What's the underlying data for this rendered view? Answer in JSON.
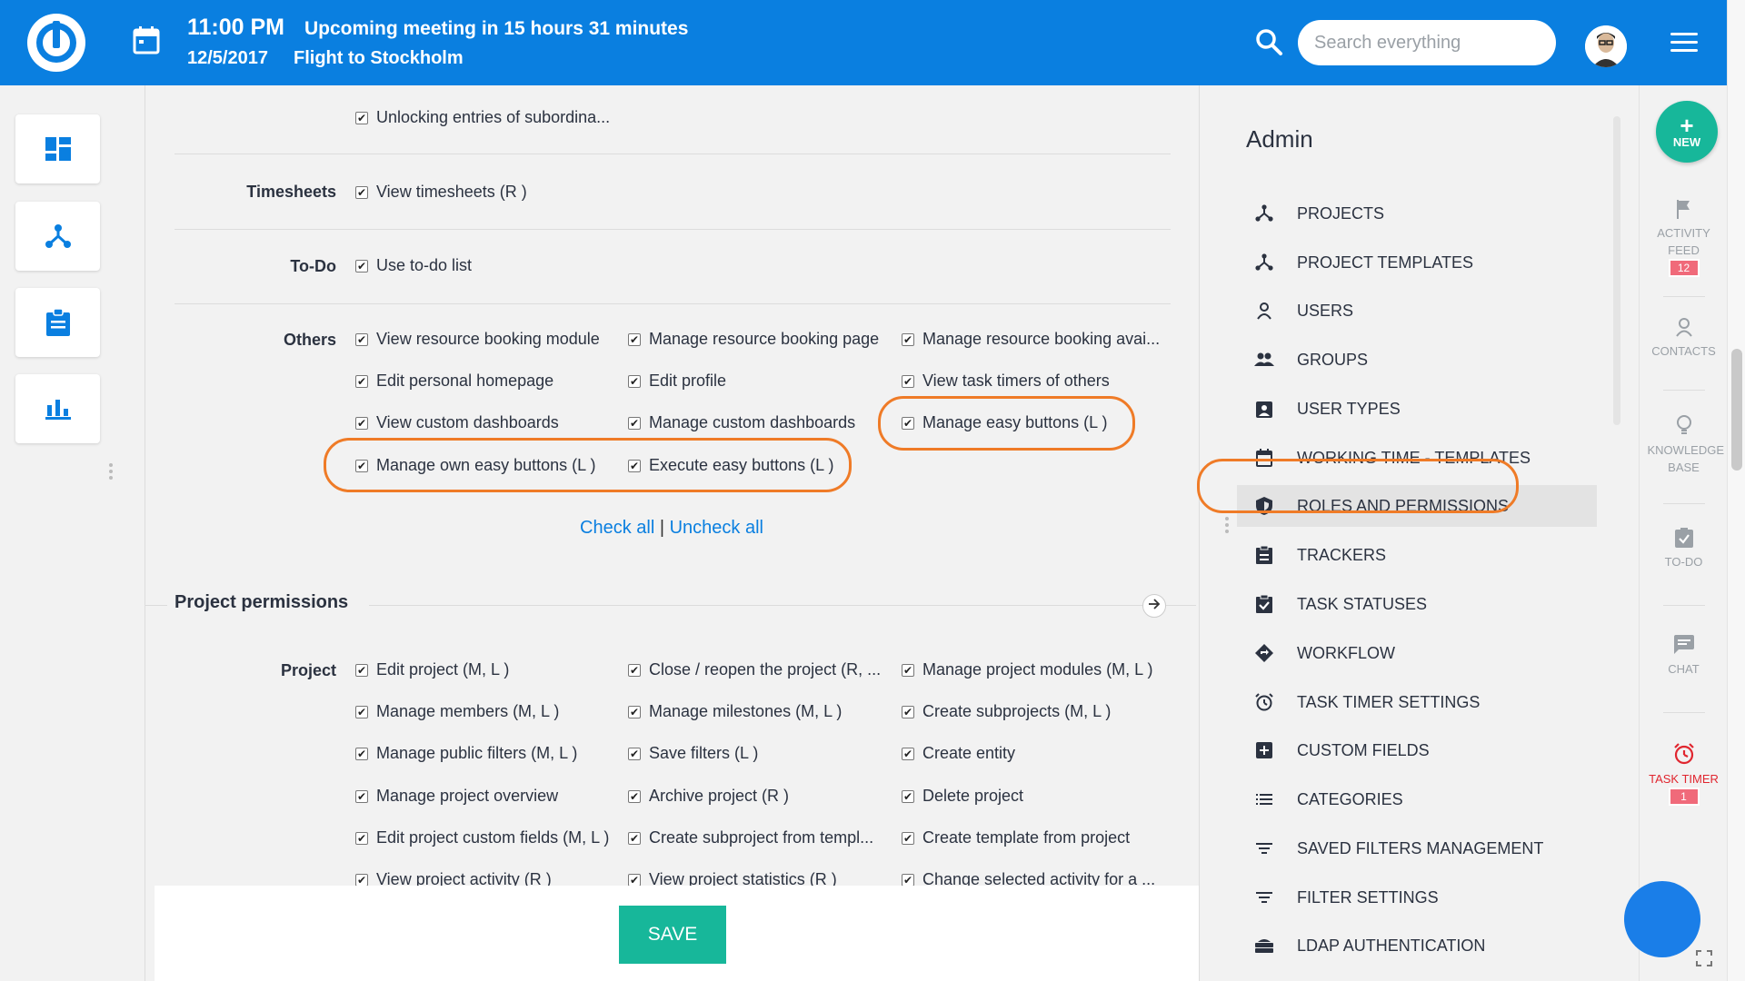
{
  "header": {
    "time": "11:00 PM",
    "upcoming": "Upcoming meeting in 15 hours 31 minutes",
    "date": "12/5/2017",
    "event": "Flight to Stockholm",
    "search_placeholder": "Search everything",
    "brand_color": "#0a7fe0"
  },
  "left_rail": {
    "items": [
      "dashboard-icon",
      "projects-icon",
      "tasks-icon",
      "reports-icon"
    ]
  },
  "permissions": {
    "top_partial": "Unlocking entries of subordina...",
    "timesheets": {
      "label": "Timesheets",
      "items": [
        "View timesheets (R )"
      ]
    },
    "todo": {
      "label": "To-Do",
      "items": [
        "Use to-do list"
      ]
    },
    "others": {
      "label": "Others",
      "items": [
        "View resource booking module",
        "Manage resource booking page",
        "Manage resource booking avai...",
        "Edit personal homepage",
        "Edit profile",
        "View task timers of others",
        "View custom dashboards",
        "Manage custom dashboards",
        "Manage easy buttons (L )",
        "Manage own easy buttons (L )",
        "Execute easy buttons (L )"
      ]
    },
    "check_all": "Check all",
    "separator": "|",
    "uncheck_all": "Uncheck all",
    "project_section_title": "Project permissions",
    "project": {
      "label": "Project",
      "items": [
        "Edit project (M, L )",
        "Close / reopen the project (R, ...",
        "Manage project modules (M, L )",
        "Manage members (M, L )",
        "Manage milestones (M, L )",
        "Create subprojects (M, L )",
        "Manage public filters (M, L )",
        "Save filters (L )",
        "Create entity",
        "Manage project overview",
        "Archive project (R )",
        "Delete project",
        "Edit project custom fields (M, L )",
        "Create subproject from templ...",
        "Create template from project",
        "View project activity (R )",
        "View project statistics (R )",
        "Change selected activity for a ..."
      ]
    },
    "save_label": "SAVE",
    "highlight_color": "#ef7b27"
  },
  "admin": {
    "title": "Admin",
    "items": [
      {
        "label": "PROJECTS",
        "icon": "project-tree-icon"
      },
      {
        "label": "PROJECT TEMPLATES",
        "icon": "project-tree-icon"
      },
      {
        "label": "USERS",
        "icon": "user-icon"
      },
      {
        "label": "GROUPS",
        "icon": "groups-icon"
      },
      {
        "label": "USER TYPES",
        "icon": "badge-icon"
      },
      {
        "label": "WORKING TIME - TEMPLATES",
        "icon": "calendar-icon"
      },
      {
        "label": "ROLES AND PERMISSIONS",
        "icon": "shield-icon",
        "active": true
      },
      {
        "label": "TRACKERS",
        "icon": "clipboard-icon"
      },
      {
        "label": "TASK STATUSES",
        "icon": "clipboard-check-icon"
      },
      {
        "label": "WORKFLOW",
        "icon": "workflow-icon"
      },
      {
        "label": "TASK TIMER SETTINGS",
        "icon": "alarm-icon"
      },
      {
        "label": "CUSTOM FIELDS",
        "icon": "plus-box-icon"
      },
      {
        "label": "CATEGORIES",
        "icon": "list-icon"
      },
      {
        "label": "SAVED FILTERS MANAGEMENT",
        "icon": "filter-icon"
      },
      {
        "label": "FILTER SETTINGS",
        "icon": "filter-icon"
      },
      {
        "label": "LDAP AUTHENTICATION",
        "icon": "server-icon"
      }
    ]
  },
  "right_rail": {
    "new_label": "NEW",
    "activity_feed": "ACTIVITY FEED",
    "activity_count": "12",
    "contacts": "CONTACTS",
    "knowledge_base": "KNOWLEDGE BASE",
    "todo": "TO-DO",
    "chat": "CHAT",
    "task_timer": "TASK TIMER",
    "task_timer_count": "1"
  }
}
